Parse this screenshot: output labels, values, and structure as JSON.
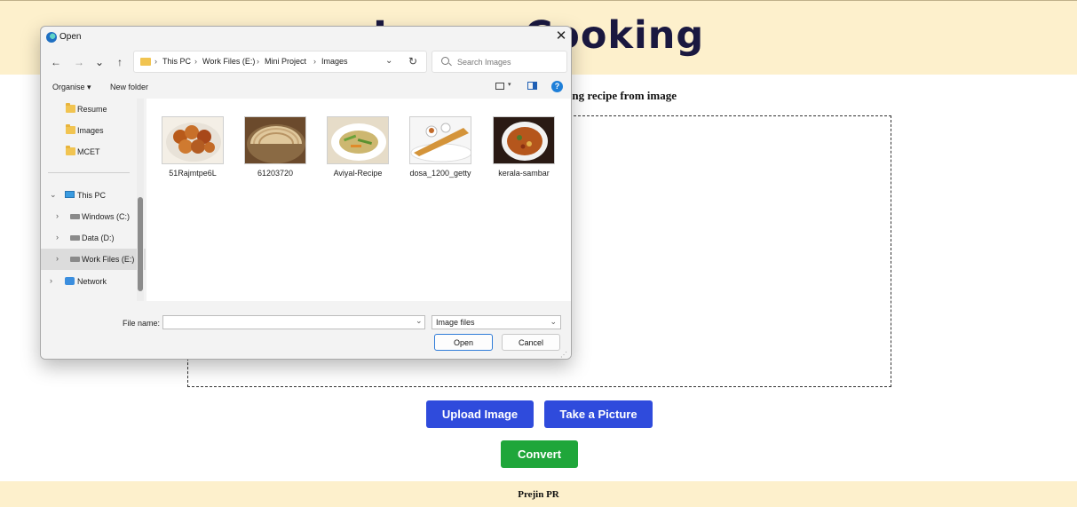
{
  "page": {
    "title": "Image Cooking",
    "subtitle": "Get cooking recipe from image",
    "buttons": {
      "upload": "Upload Image",
      "camera": "Take a Picture",
      "convert": "Convert"
    },
    "footer": "Prejin PR",
    "colors": {
      "header_bg": "#fdf0cc",
      "title": "#1a1840",
      "primary_button": "#2f4bdc",
      "convert_button": "#1fa63a"
    }
  },
  "dialog": {
    "title": "Open",
    "close_icon": "close-icon",
    "nav": {
      "back_icon": "←",
      "forward_icon": "→",
      "recent_icon": "⌄",
      "up_icon": "↑"
    },
    "breadcrumb": [
      "This PC",
      "Work Files (E:)",
      "Mini Project",
      "Images"
    ],
    "breadcrumb_separator": "›",
    "search_placeholder": "Search Images",
    "commands": {
      "organise": "Organise ▾",
      "new_folder": "New folder",
      "help": "?"
    },
    "nav_pane": {
      "quick_folders": [
        "Resume",
        "Images",
        "MCET"
      ],
      "this_pc": "This PC",
      "drives": [
        "Windows (C:)",
        "Data (D:)",
        "Work Files (E:)"
      ],
      "selected_drive": "Work Files (E:)",
      "network": "Network"
    },
    "files": [
      {
        "name": "51Rajmtpe6L",
        "icon": "image-thumbnail"
      },
      {
        "name": "61203720",
        "icon": "image-thumbnail"
      },
      {
        "name": "Aviyal-Recipe",
        "icon": "image-thumbnail"
      },
      {
        "name": "dosa_1200_getty",
        "icon": "image-thumbnail"
      },
      {
        "name": "kerala-sambar",
        "icon": "image-thumbnail"
      }
    ],
    "file_name_label": "File name:",
    "file_name_value": "",
    "file_type": "Image files",
    "open_button": "Open",
    "cancel_button": "Cancel"
  }
}
